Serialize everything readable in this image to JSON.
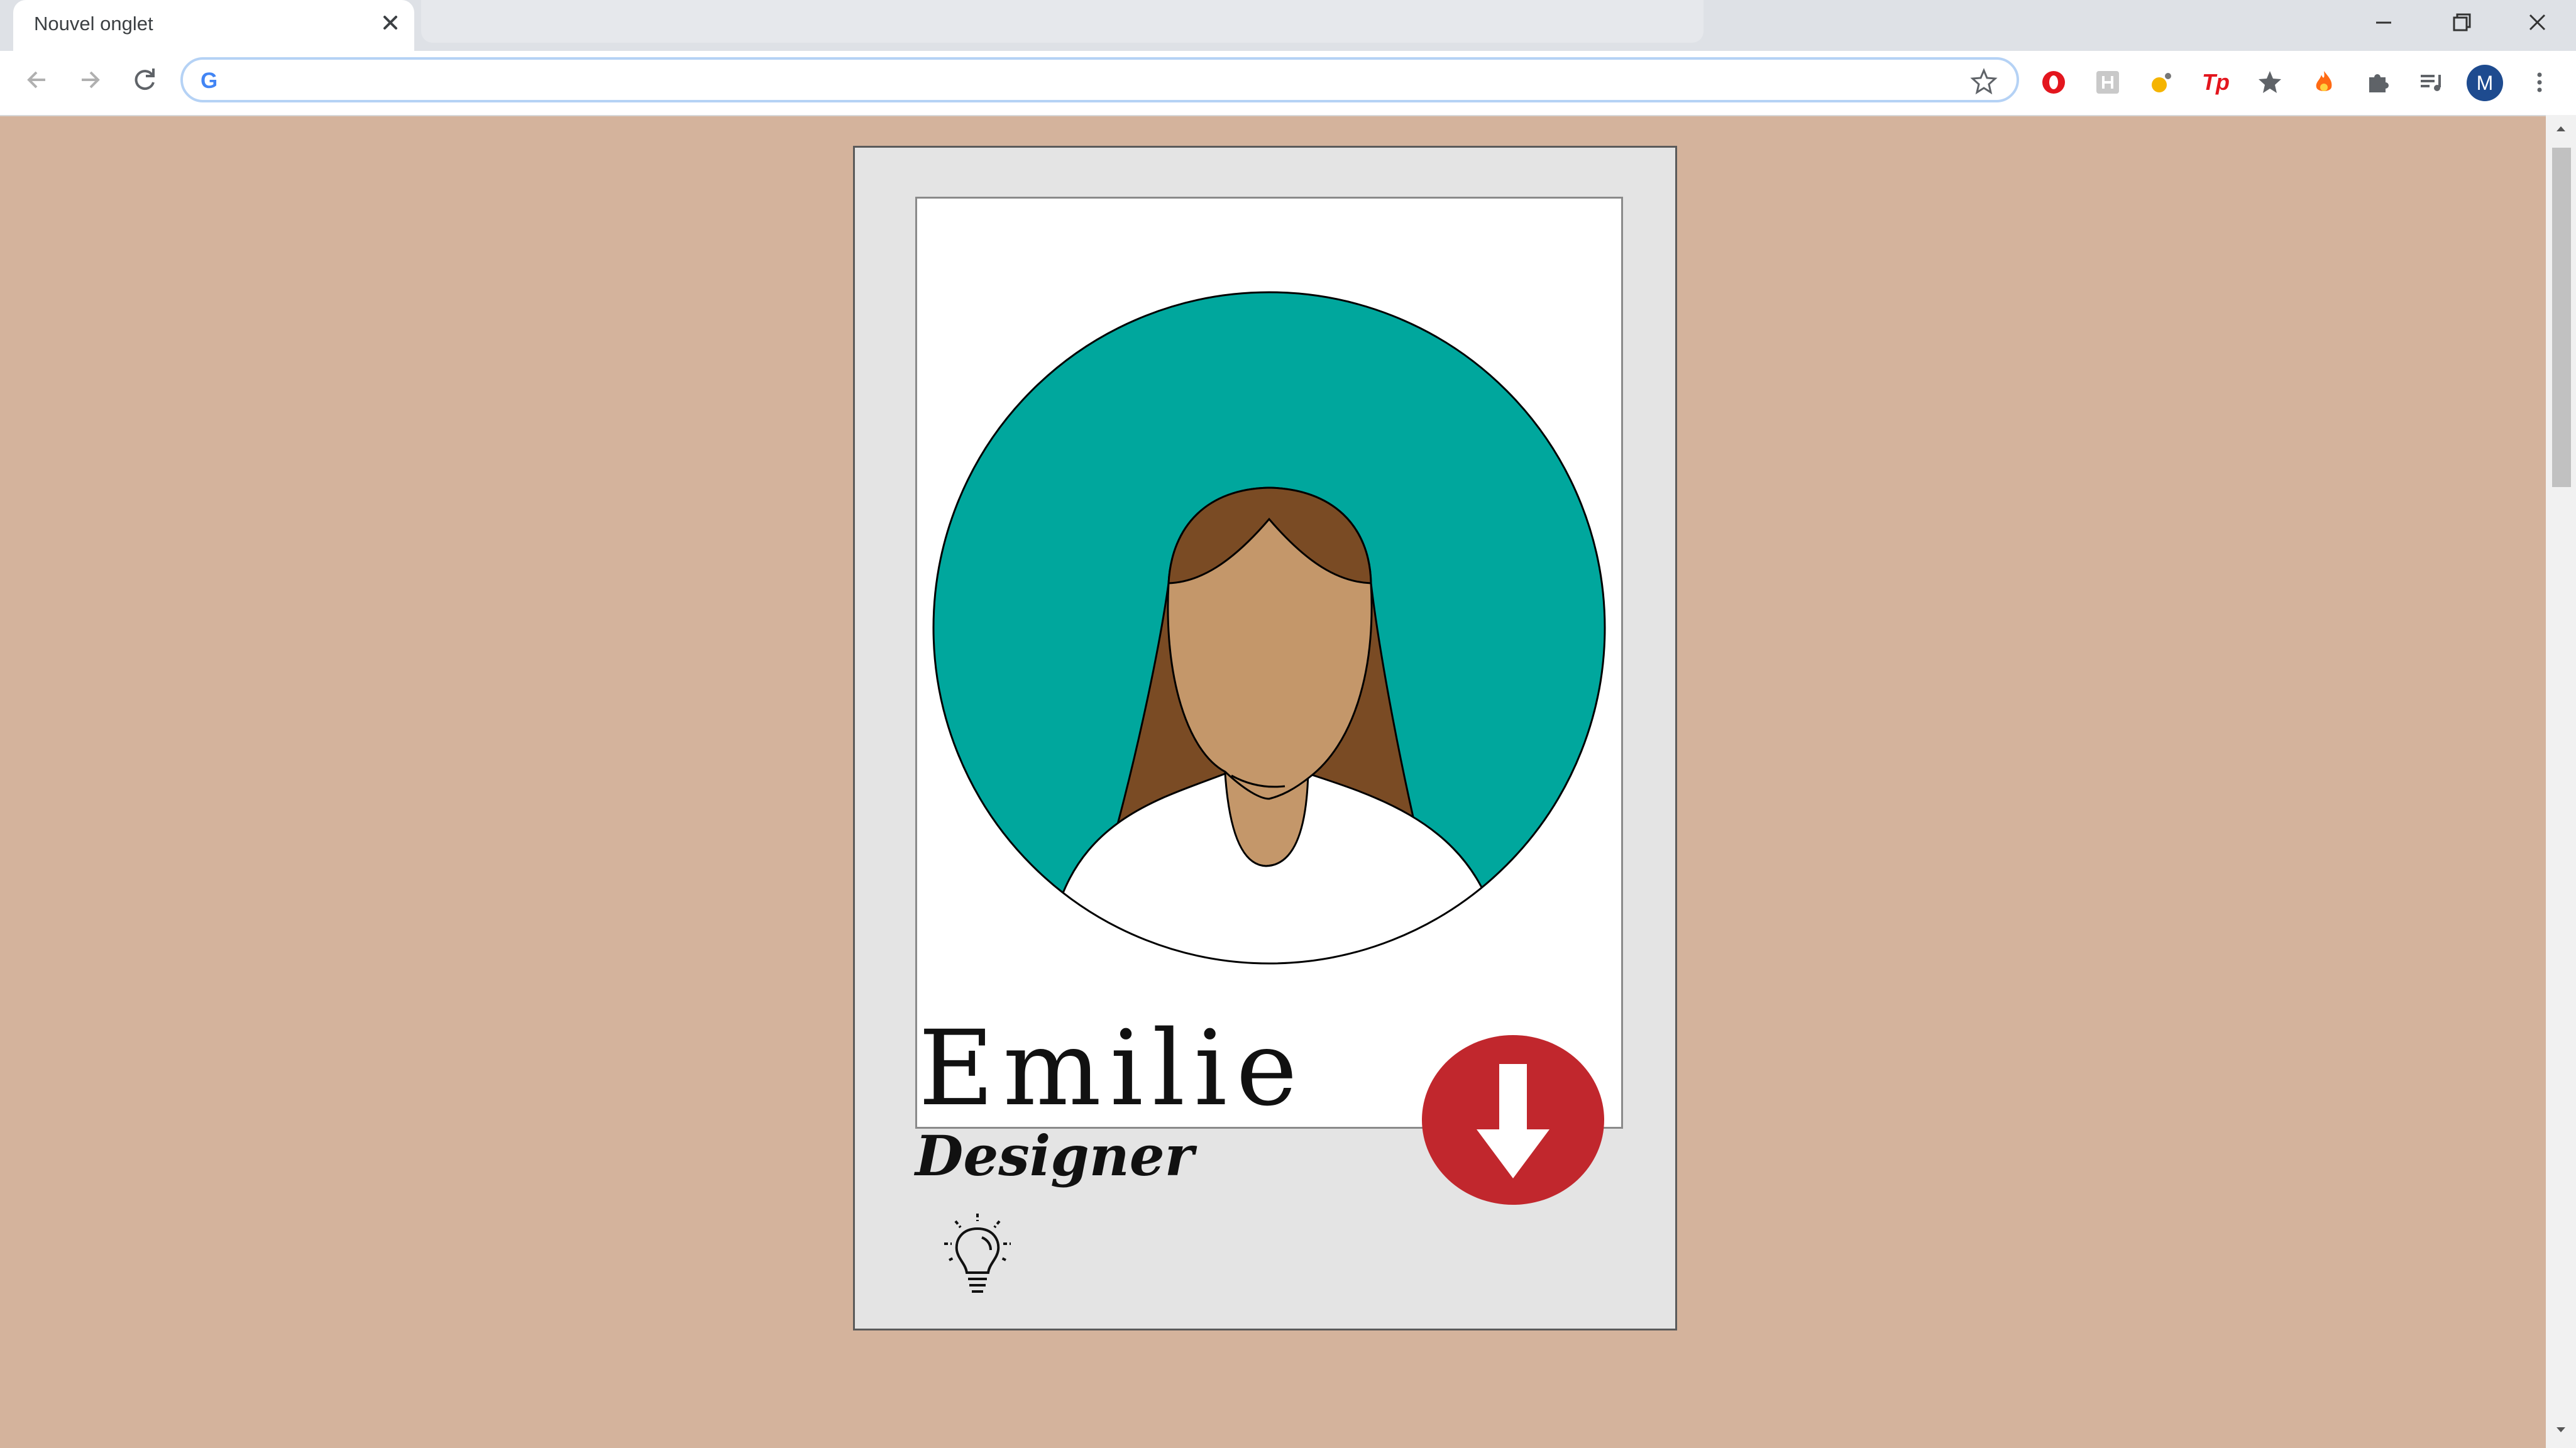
{
  "browser": {
    "tab_title": "Nouvel onglet",
    "address_value": "",
    "profile_initial": "M",
    "icons": [
      "back-icon",
      "forward-icon",
      "reload-icon",
      "google-icon",
      "bookmark-star-icon",
      "opera-icon",
      "extension-h-icon",
      "extension-weather-icon",
      "tp-icon",
      "star-extension-icon",
      "fire-extension-icon",
      "puzzle-icon",
      "media-queue-icon",
      "kebab-menu-icon"
    ]
  },
  "card": {
    "name": "Emilie",
    "role": "Designer"
  },
  "colors": {
    "page_background": "#d4b39c",
    "card_background": "#e4e4e4",
    "circle": "#00a79d",
    "hair": "#7a4b24",
    "skin": "#c4976a",
    "download_button": "#c1272d"
  }
}
